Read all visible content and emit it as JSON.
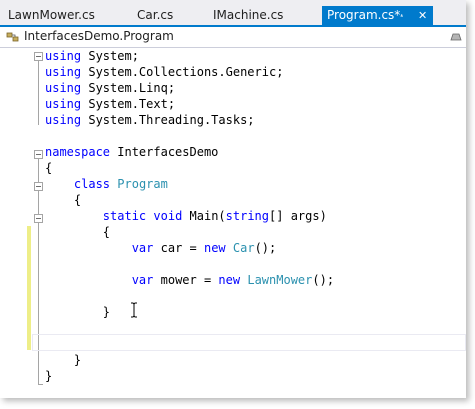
{
  "tabs": [
    {
      "label": "LawnMower.cs",
      "active": false
    },
    {
      "label": "Car.cs",
      "active": false
    },
    {
      "label": "IMachine.cs",
      "active": false
    },
    {
      "label": "Program.cs*",
      "active": true
    }
  ],
  "active_tab_icons": {
    "pin": "pin-icon",
    "close": "close-icon"
  },
  "navbar": {
    "label": "InterfacesDemo.Program",
    "left_icon": "class-icon",
    "right_icon": "member-icon"
  },
  "code": {
    "line1": {
      "kw": "using",
      "rest": " System;"
    },
    "line2": {
      "kw": "using",
      "rest": " System.Collections.Generic;"
    },
    "line3": {
      "kw": "using",
      "rest": " System.Linq;"
    },
    "line4": {
      "kw": "using",
      "rest": " System.Text;"
    },
    "line5": {
      "kw": "using",
      "rest": " System.Threading.Tasks;"
    },
    "line7": {
      "kw": "namespace",
      "rest": " InterfacesDemo"
    },
    "line8": {
      "text": "{"
    },
    "line9": {
      "indent": "    ",
      "kw": "class",
      "space": " ",
      "type": "Program"
    },
    "line10": {
      "text": "    {"
    },
    "line11": {
      "indent": "        ",
      "kw1": "static",
      "sp1": " ",
      "kw2": "void",
      "mid": " Main(",
      "kw3": "string",
      "rest": "[] args)"
    },
    "line12": {
      "text": "        {"
    },
    "line13": {
      "indent": "            ",
      "kw1": "var",
      "mid": " car = ",
      "kw2": "new",
      "sp": " ",
      "type": "Car",
      "rest": "();"
    },
    "line15": {
      "indent": "            ",
      "kw1": "var",
      "mid": " mower = ",
      "kw2": "new",
      "sp": " ",
      "type": "LawnMower",
      "rest": "();"
    },
    "line17": {
      "text": "        }"
    },
    "line20": {
      "text": "    }"
    },
    "line21": {
      "text": "}"
    }
  },
  "colors": {
    "keyword": "#0000ff",
    "type": "#2b91af",
    "accent": "#007acc",
    "change_marker": "#eeee88"
  }
}
